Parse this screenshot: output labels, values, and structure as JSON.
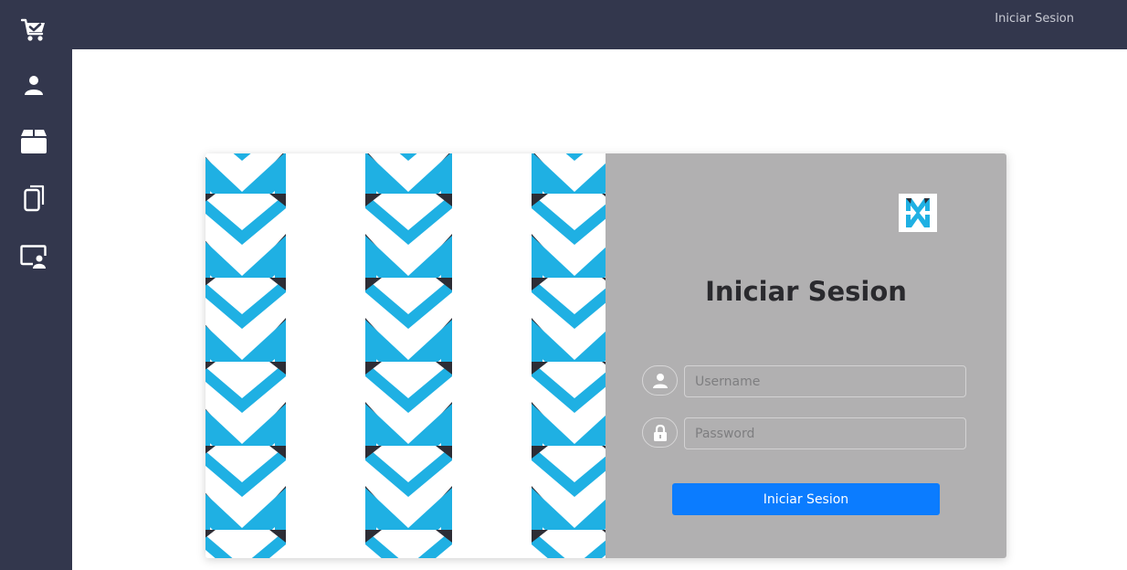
{
  "app": {
    "brand_color": "#1fb0e3",
    "sidebar_color": "#33374d",
    "accent_color": "#0b7cff"
  },
  "sidebar": {
    "items": [
      {
        "icon": "cart-check-icon"
      },
      {
        "icon": "user-icon"
      },
      {
        "icon": "box-icon"
      },
      {
        "icon": "documents-icon"
      },
      {
        "icon": "user-screen-icon"
      }
    ]
  },
  "topbar": {
    "login_link": "Iniciar Sesion"
  },
  "login": {
    "title": "Iniciar Sesion",
    "username": {
      "value": "",
      "placeholder": "Username",
      "icon": "user-icon"
    },
    "password": {
      "value": "",
      "placeholder": "Password",
      "icon": "lock-icon"
    },
    "submit_label": "Iniciar Sesion",
    "logo_icon": "mw-logo-icon"
  }
}
